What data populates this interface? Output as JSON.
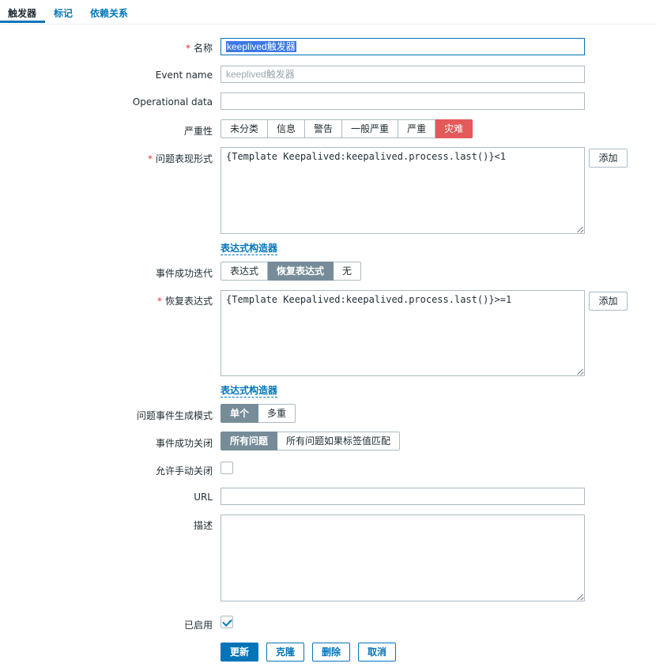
{
  "tabs": [
    {
      "label": "触发器",
      "active": true
    },
    {
      "label": "标记",
      "active": false
    },
    {
      "label": "依赖关系",
      "active": false
    }
  ],
  "form": {
    "name": {
      "label": "名称",
      "required": true,
      "value": "keeplived触发器"
    },
    "event_name": {
      "label": "Event name",
      "placeholder": "keeplived触发器",
      "value": ""
    },
    "operational_data": {
      "label": "Operational data",
      "value": ""
    },
    "severity": {
      "label": "严重性",
      "options": [
        "未分类",
        "信息",
        "警告",
        "一般严重",
        "严重",
        "灾难"
      ],
      "selected": "灾难"
    },
    "problem_expression": {
      "label": "问题表现形式",
      "required": true,
      "value": "{Template Keepalived:keepalived.process.last()}<1",
      "add_button": "添加",
      "constructor_link": "表达式构造器"
    },
    "ok_event_generation": {
      "label": "事件成功迭代",
      "options": [
        "表达式",
        "恢复表达式",
        "无"
      ],
      "selected": "恢复表达式"
    },
    "recovery_expression": {
      "label": "恢复表达式",
      "required": true,
      "value": "{Template Keepalived:keepalived.process.last()}>=1",
      "add_button": "添加",
      "constructor_link": "表达式构造器"
    },
    "problem_event_mode": {
      "label": "问题事件生成模式",
      "options": [
        "单个",
        "多重"
      ],
      "selected": "单个"
    },
    "ok_event_closes": {
      "label": "事件成功关闭",
      "options": [
        "所有问题",
        "所有问题如果标签值匹配"
      ],
      "selected": "所有问题"
    },
    "allow_manual_close": {
      "label": "允许手动关闭",
      "checked": false
    },
    "url": {
      "label": "URL",
      "value": ""
    },
    "description": {
      "label": "描述",
      "value": ""
    },
    "enabled": {
      "label": "已启用",
      "checked": true
    }
  },
  "actions": {
    "update": "更新",
    "clone": "克隆",
    "delete": "删除",
    "cancel": "取消"
  },
  "colors": {
    "accent": "#0275b8",
    "selected_segment": "#768d99",
    "disaster": "#e45959",
    "required": "#e33734"
  }
}
